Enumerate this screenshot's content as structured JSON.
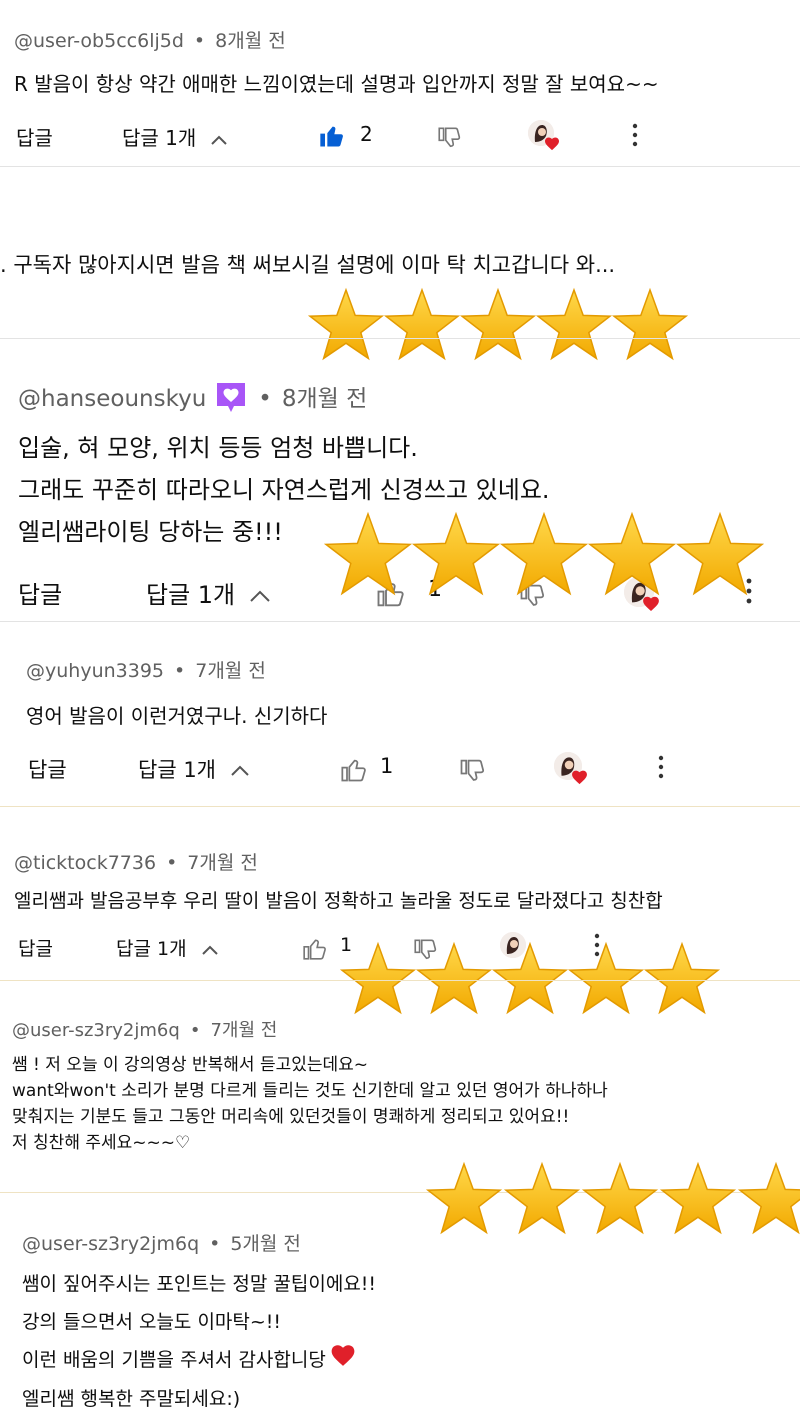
{
  "colors": {
    "like_active": "#065fd4",
    "star": "#ffc20e",
    "heart": "#e0202a",
    "badge": "#a855f7"
  },
  "comments": [
    {
      "author": "@user-ob5cc6lj5d",
      "time": "8개월 전",
      "lines": [
        "R 발음이 항상 약간 애매한 느낌이였는데 설명과 입안까지 정말 잘 보여요~~"
      ],
      "reply_label": "답글",
      "replies_label": "답글 1개",
      "likes": "2"
    },
    {
      "lines": [
        ". 구독자 많아지시면 발음 책 써보시길  설명에 이마 탁 치고갑니다 와..."
      ]
    },
    {
      "author": "@hanseounskyu",
      "time": "8개월 전",
      "lines": [
        "입술, 혀 모양, 위치 등등 엄청 바쁩니다.",
        "그래도 꾸준히 따라오니 자연스럽게 신경쓰고 있네요.",
        "엘리쌤라이팅 당하는 중!!!"
      ],
      "reply_label": "답글",
      "replies_label": "답글 1개",
      "likes": "1"
    },
    {
      "author": "@yuhyun3395",
      "time": "7개월 전",
      "lines": [
        "영어 발음이 이런거였구나.  신기하다"
      ],
      "reply_label": "답글",
      "replies_label": "답글 1개",
      "likes": "1"
    },
    {
      "author": "@ticktock7736",
      "time": "7개월 전",
      "lines": [
        "엘리쌤과 발음공부후 우리 딸이 발음이 정확하고 놀라울 정도로 달라졌다고 칭찬합"
      ],
      "reply_label": "답글",
      "replies_label": "답글 1개",
      "likes": "1"
    },
    {
      "author": "@user-sz3ry2jm6q",
      "time": "7개월 전",
      "lines": [
        "쌤 ! 저 오늘 이 강의영상 반복해서 듣고있는데요~",
        "want와won't 소리가  분명 다르게 들리는  것도 신기한데 알고 있던 영어가 하나하나",
        "맞춰지는 기분도 들고 그동안 머리속에 있던것들이 명쾌하게 정리되고 있어요!!",
        "저 칭찬해 주세요~~~♡"
      ]
    },
    {
      "author": "@user-sz3ry2jm6q",
      "time": "5개월 전",
      "lines": [
        "쌤이 짚어주시는 포인트는 정말 꿀팁이에요!!",
        "강의 들으면서 오늘도 이마탁~!!",
        "이런 배움의 기쁨을  주셔서 감사합니당",
        "엘리쌤 행복한 주말되세요:)"
      ]
    }
  ],
  "icons": {
    "like": "thumbs-up-icon",
    "dislike": "thumbs-down-icon",
    "more": "more-vert-icon",
    "expand": "chevron-up-icon",
    "rating": "star-icon",
    "heart": "heart-icon",
    "badge": "member-badge-icon"
  }
}
